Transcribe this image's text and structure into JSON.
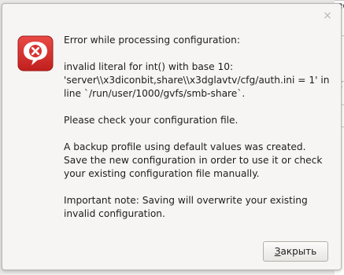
{
  "dialog": {
    "close_glyph": "×",
    "icon": "error-icon",
    "title": "Error while processing configuration:",
    "detail": "invalid literal for int() with base 10: 'server\\\\x3diconbit,share\\\\x3dglavtv/cfg/auth.ini = 1' in line `/run/user/1000/gvfs/smb-share`.",
    "instruction": "Please check your configuration file.",
    "backup_notice": "A backup profile using default values was created. Save the new configuration in order to use it or check your existing configuration file manually.",
    "important_note": "Important note: Saving will overwrite your existing invalid configuration.",
    "close_button": {
      "mnemonic": "З",
      "rest": "акрыть"
    },
    "colors": {
      "icon_red": "#d9322f",
      "icon_dark_red": "#9e1a18",
      "background": "#f6f5f4"
    }
  },
  "background": {
    "fragments": [
      "ec",
      "t",
      "/"
    ]
  }
}
